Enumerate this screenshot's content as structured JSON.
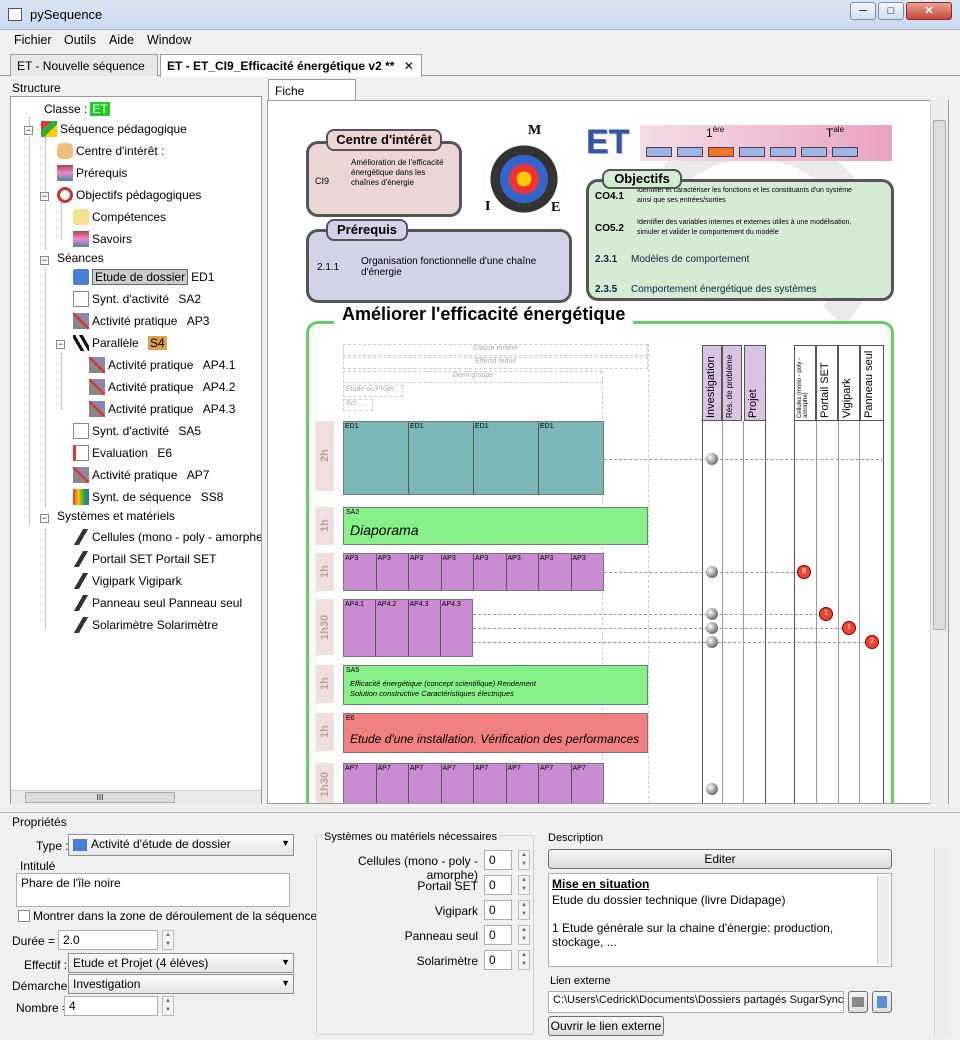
{
  "window": {
    "title": "pySequence",
    "btn_min": "─",
    "btn_max": "□",
    "btn_close": "✕"
  },
  "menu": [
    "Fichier",
    "Outils",
    "Aide",
    "Window"
  ],
  "tabs": [
    {
      "label": "ET - Nouvelle séquence"
    },
    {
      "label": "ET - ET_CI9_Efficacité énergétique v2 **"
    }
  ],
  "structure": {
    "header": "Structure",
    "classe_label": "Classe :",
    "classe_value": "ET",
    "seq": "Séquence pédagogique",
    "ci": "Centre d'intérêt :",
    "prereq": "Prérequis",
    "objectifs": "Objectifs pédagogiques",
    "competences": "Compétences",
    "savoirs": "Savoirs",
    "seances": "Séances",
    "items": [
      {
        "label": "Etude de dossier",
        "code": "ED1"
      },
      {
        "label": "Synt. d'activité",
        "code": "SA2"
      },
      {
        "label": "Activité pratique",
        "code": "AP3"
      },
      {
        "label": "Parallèle",
        "code": "S4"
      },
      {
        "label": "Activité pratique",
        "code": "AP4.1"
      },
      {
        "label": "Activité pratique",
        "code": "AP4.2"
      },
      {
        "label": "Activité pratique",
        "code": "AP4.3"
      },
      {
        "label": "Synt. d'activité",
        "code": "SA5"
      },
      {
        "label": "Evaluation",
        "code": "E6"
      },
      {
        "label": "Activité pratique",
        "code": "AP7"
      },
      {
        "label": "Synt. de séquence",
        "code": "SS8"
      }
    ],
    "systemes": "Systèmes et matériels",
    "sys_items": [
      "Cellules (mono - poly - amorphe)",
      "Portail SET  Portail SET",
      "Vigipark  Vigipark",
      "Panneau seul  Panneau seul",
      "Solarimètre  Solarimètre"
    ],
    "scroll": "III"
  },
  "fiche": {
    "tab": "Fiche Séquence",
    "ci_title": "Centre d'intérêt",
    "ci_code": "CI9",
    "ci_text": "Amélioration de l'efficacité énergétique dans les chaînes d'énergie",
    "pre_title": "Prérequis",
    "pre_code": "2.1.1",
    "pre_text": "Organisation fonctionnelle d'une chaîne d'énergie",
    "target_m": "M",
    "target_i": "I",
    "target_e": "E",
    "et": "ET",
    "first": "1",
    "first_sup": "ère",
    "term": "T",
    "term_sup": "ale",
    "obj_title": "Objectifs",
    "obj": [
      {
        "code": "CO4.1",
        "text": "Identifier et caractériser les fonctions et les constituants d'un système ainsi que ses entrées/sorties"
      },
      {
        "code": "CO5.2",
        "text": "Identifier des variables internes et externes utiles à une modélisation, simuler et valider le comportement du modèle"
      },
      {
        "code": "2.3.1",
        "text": "Modèles de comportement"
      },
      {
        "code": "2.3.5",
        "text": "Comportement énergétique des systèmes"
      }
    ],
    "seq_title": "Améliorer l'efficacité énergétique",
    "eff": [
      "Classe entière",
      "Effectif réduit",
      "Demi-groupe",
      "Etude ou Projet",
      "Act. ..."
    ],
    "demarches": [
      "Investigation",
      "Rés. de problème",
      "Projet"
    ],
    "systemes": [
      "Cellules (mono - poly - amorphe)",
      "Portail SET",
      "Vigipark",
      "Panneau seul"
    ],
    "rows": [
      {
        "dur": "2h",
        "labels": [
          "ED1",
          "ED1",
          "ED1",
          "ED1"
        ]
      },
      {
        "dur": "1h",
        "code": "SA2",
        "text": "Diaporama"
      },
      {
        "dur": "1h",
        "labels": [
          "AP3",
          "AP3",
          "AP3",
          "AP3",
          "AP3",
          "AP3",
          "AP3",
          "AP3"
        ]
      },
      {
        "dur": "1h30",
        "labels": [
          "AP4.1",
          "AP4.2",
          "AP4.3",
          "AP4.3"
        ]
      },
      {
        "dur": "1h",
        "code": "SA5",
        "text": "Efficacité énergétique (concept scientifique) Rendement\nSolution constructive Caractéristiques électriques"
      },
      {
        "dur": "1h",
        "code": "E6",
        "text": "Etude d'une installation. Vérification des performances"
      },
      {
        "dur": "1h30",
        "labels": [
          "AP7",
          "AP7",
          "AP7",
          "AP7",
          "AP7",
          "AP7",
          "AP7",
          "AP7"
        ]
      }
    ],
    "markers": [
      "8",
      "1",
      "1",
      "2"
    ]
  },
  "props": {
    "header": "Propriétés",
    "type_label": "Type :",
    "type_value": "Activité d'étude de dossier",
    "intitule_label": "Intitulé",
    "intitule_value": "Phare de l'île noire",
    "montrer": "Montrer dans la zone de déroulement de la séquence",
    "duree_label": "Durée =",
    "duree_value": "2.0",
    "effectif_label": "Effectif :",
    "effectif_value": "Etude et Projet (4 élèves)",
    "demarche_label": "Démarche :",
    "demarche_value": "Investigation",
    "nombre_label": "Nombre =",
    "nombre_value": "4",
    "sys_header": "Systèmes ou matériels nécessaires",
    "sys": [
      {
        "name": "Cellules (mono - poly - amorphe)",
        "val": "0"
      },
      {
        "name": "Portail SET",
        "val": "0"
      },
      {
        "name": "Vigipark",
        "val": "0"
      },
      {
        "name": "Panneau seul",
        "val": "0"
      },
      {
        "name": "Solarimètre",
        "val": "0"
      }
    ],
    "desc_header": "Description",
    "editer": "Editer",
    "desc_title": "Mise en situation",
    "desc_line1": "Etude du dossier technique (livre Didapage)",
    "desc_line2": "1         Etude générale sur la chaine d'énergie: production, stockage, ...",
    "lien_header": "Lien externe",
    "lien_value": "C:\\Users\\Cedrick\\Documents\\Dossiers partagés SugarSync\\je",
    "ouvrir": "Ouvrir le lien externe"
  }
}
